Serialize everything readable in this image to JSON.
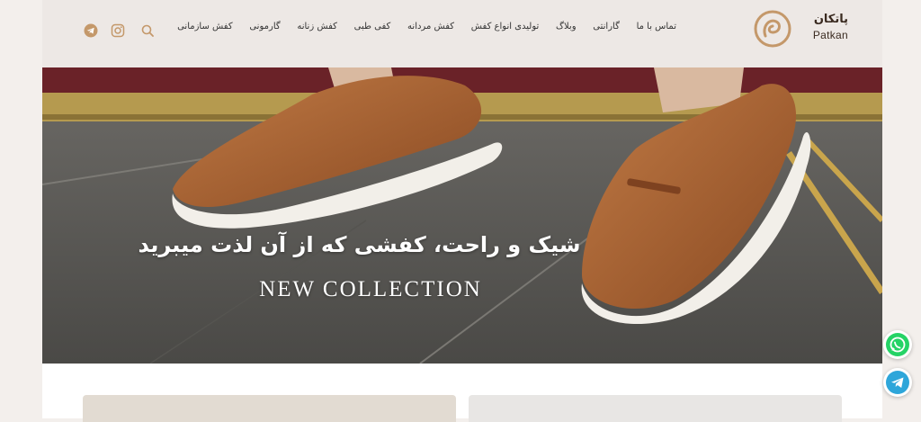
{
  "brand": {
    "name_fa": "پاتکان",
    "name_en": "Patkan"
  },
  "nav": {
    "items": [
      "کفش سازمانی",
      "گارمونی",
      "کفش زنانه",
      "کفی طبی",
      "کفش مردانه",
      "تولیدی انواع کفش",
      "وبلاگ",
      "گارانتی",
      "تماس با ما"
    ]
  },
  "icons": {
    "search": "search-icon",
    "instagram": "instagram-icon",
    "telegram": "telegram-icon",
    "whatsapp": "whatsapp-icon"
  },
  "hero": {
    "title": "شیک و راحت، کفشی که از آن لذت میبرید",
    "subtitle": "NEW COLLECTION"
  },
  "colors": {
    "accent": "#c4986a",
    "header_bg": "#ede8e5",
    "whatsapp": "#25d366",
    "telegram": "#2ea6da"
  }
}
